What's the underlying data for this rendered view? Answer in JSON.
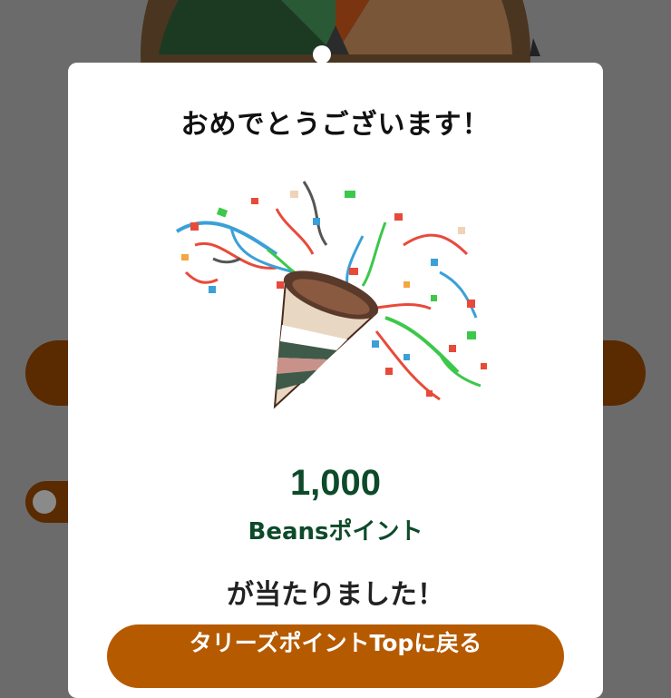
{
  "modal": {
    "title": "おめでとうございます！",
    "amount": "1,000",
    "unit": "Beansポイント",
    "won_text": "が当たりました！",
    "cta_label": "タリーズポイントTopに戻る"
  },
  "illustration": {
    "icon": "party-popper-icon"
  },
  "colors": {
    "overlay": "#6b6b6b",
    "amount_text": "#0d4a2a",
    "cta_button": "#b65a00",
    "background_pill": "#5a2a00"
  }
}
